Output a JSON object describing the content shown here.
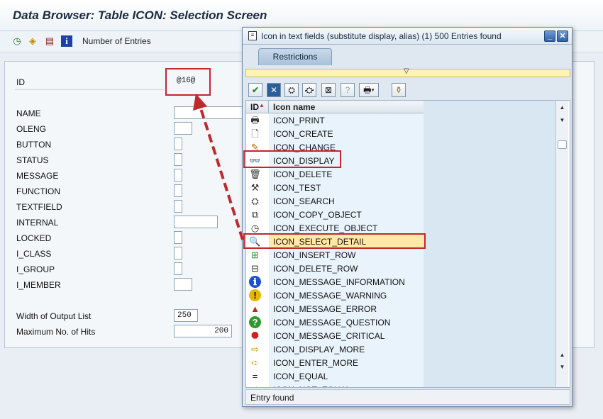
{
  "app": {
    "title": "Data Browser: Table ICON: Selection Screen"
  },
  "toolbar": {
    "number_of_entries_label": "Number of Entries",
    "icons": [
      "execute-icon",
      "field-selection-icon",
      "save-icon",
      "info-icon"
    ]
  },
  "fields": [
    {
      "label": "ID",
      "value": "@16@",
      "kind": "text"
    },
    {
      "label": "NAME",
      "value": "",
      "kind": "text"
    },
    {
      "label": "OLENG",
      "value": "",
      "kind": "short"
    },
    {
      "label": "BUTTON",
      "value": "",
      "kind": "checkbox"
    },
    {
      "label": "STATUS",
      "value": "",
      "kind": "checkbox"
    },
    {
      "label": "MESSAGE",
      "value": "",
      "kind": "checkbox"
    },
    {
      "label": "FUNCTION",
      "value": "",
      "kind": "checkbox"
    },
    {
      "label": "TEXTFIELD",
      "value": "",
      "kind": "checkbox"
    },
    {
      "label": "INTERNAL",
      "value": "",
      "kind": "text"
    },
    {
      "label": "LOCKED",
      "value": "",
      "kind": "checkbox"
    },
    {
      "label": "I_CLASS",
      "value": "",
      "kind": "checkbox"
    },
    {
      "label": "I_GROUP",
      "value": "",
      "kind": "checkbox"
    },
    {
      "label": "I_MEMBER",
      "value": "",
      "kind": "short"
    }
  ],
  "output": {
    "width_label": "Width of Output List",
    "width_value": "250",
    "max_hits_label": "Maximum No. of Hits",
    "max_hits_value": "200"
  },
  "dialog": {
    "title": "Icon in text fields (substitute display, alias) (1)  500 Entries found",
    "tab_label": "Restrictions",
    "col_id": "ID",
    "col_name": "Icon name",
    "status": "Entry found",
    "toolbar_icons": [
      "checkmark-icon",
      "cancel-icon",
      "find-icon",
      "find-next-icon",
      "filter-icon",
      "help-icon",
      "print-icon",
      "clear-icon"
    ],
    "rows": [
      {
        "name": "ICON_PRINT",
        "icon": "printer-icon",
        "glyph": "🖶",
        "color": "#333333"
      },
      {
        "name": "ICON_CREATE",
        "icon": "blank-page-icon",
        "glyph": "🗋",
        "color": "#333333"
      },
      {
        "name": "ICON_CHANGE",
        "icon": "pencil-icon",
        "glyph": "✎",
        "color": "#a86c00"
      },
      {
        "name": "ICON_DISPLAY",
        "icon": "glasses-icon",
        "glyph": "👓",
        "color": "#333333"
      },
      {
        "name": "ICON_DELETE",
        "icon": "trash-icon",
        "glyph": "🗑",
        "color": "#333333"
      },
      {
        "name": "ICON_TEST",
        "icon": "test-icon",
        "glyph": "⚒",
        "color": "#333333"
      },
      {
        "name": "ICON_SEARCH",
        "icon": "binoculars-icon",
        "glyph": "⛭",
        "color": "#333333"
      },
      {
        "name": "ICON_COPY_OBJECT",
        "icon": "copy-icon",
        "glyph": "⧉",
        "color": "#333333"
      },
      {
        "name": "ICON_EXECUTE_OBJECT",
        "icon": "execute-clock-icon",
        "glyph": "◷",
        "color": "#333333"
      },
      {
        "name": "ICON_SELECT_DETAIL",
        "icon": "magnifier-icon",
        "glyph": "🔍",
        "color": "#2a5d9c"
      },
      {
        "name": "ICON_INSERT_ROW",
        "icon": "insert-row-icon",
        "glyph": "⊞",
        "color": "#2e8b2e"
      },
      {
        "name": "ICON_DELETE_ROW",
        "icon": "delete-row-icon",
        "glyph": "⊟",
        "color": "#333333"
      },
      {
        "name": "ICON_MESSAGE_INFORMATION",
        "icon": "info-circle-icon",
        "glyph": "ℹ",
        "color": "#1d4fd6"
      },
      {
        "name": "ICON_MESSAGE_WARNING",
        "icon": "warning-circle-icon",
        "glyph": "!",
        "color": "#e5b700"
      },
      {
        "name": "ICON_MESSAGE_ERROR",
        "icon": "error-triangle-icon",
        "glyph": "▲",
        "color": "#d0201c"
      },
      {
        "name": "ICON_MESSAGE_QUESTION",
        "icon": "question-circle-icon",
        "glyph": "?",
        "color": "#2e9a2e"
      },
      {
        "name": "ICON_MESSAGE_CRITICAL",
        "icon": "stop-sign-icon",
        "glyph": "⯃",
        "color": "#d0201c"
      },
      {
        "name": "ICON_DISPLAY_MORE",
        "icon": "display-more-icon",
        "glyph": "⇨",
        "color": "#c89a00"
      },
      {
        "name": "ICON_ENTER_MORE",
        "icon": "enter-more-icon",
        "glyph": "➪",
        "color": "#c89a00"
      },
      {
        "name": "ICON_EQUAL",
        "icon": "equal-icon",
        "glyph": "=",
        "color": "#111111"
      },
      {
        "name": "ICON_NOT_EQUAL",
        "icon": "not-equal-icon",
        "glyph": "≠",
        "color": "#111111"
      }
    ],
    "selected_row": "ICON_SELECT_DETAIL",
    "boxed_row": "ICON_DISPLAY"
  },
  "colors": {
    "highlight": "#c0282e",
    "selected_row": "#ffe9a6"
  }
}
